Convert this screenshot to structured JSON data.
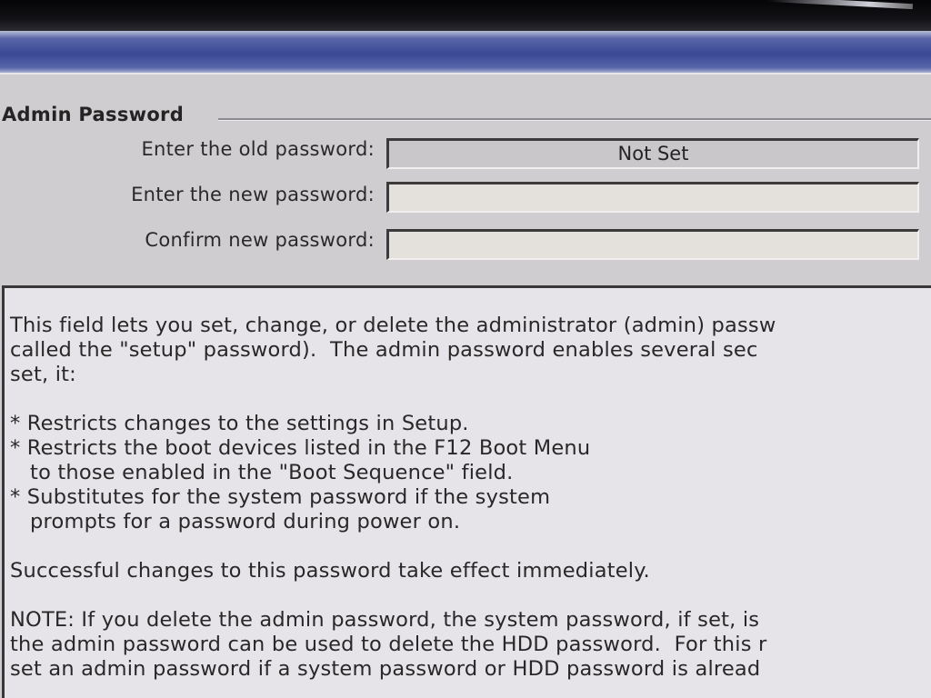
{
  "admin_password": {
    "group_title": "Admin Password",
    "old_password": {
      "label": "Enter the old password:",
      "value": "Not Set"
    },
    "new_password": {
      "label": "Enter the new password:",
      "value": ""
    },
    "confirm_password": {
      "label": "Confirm new password:",
      "value": ""
    }
  },
  "help": {
    "intro_lines": [
      "This field lets you set, change, or delete the administrator (admin) passw",
      "called the \"setup\" password).  The admin password enables several sec",
      "set, it:"
    ],
    "bullet_lines": [
      "* Restricts changes to the settings in Setup.",
      "* Restricts the boot devices listed in the F12 Boot Menu",
      "   to those enabled in the \"Boot Sequence\" field.",
      "* Substitutes for the system password if the system",
      "   prompts for a password during power on."
    ],
    "effect_line": "Successful changes to this password take effect immediately.",
    "note_lines": [
      "NOTE: If you delete the admin password, the system password, if set, is",
      "the admin password can be used to delete the HDD password.  For this r",
      "set an admin password if a system password or HDD password is alread"
    ]
  }
}
